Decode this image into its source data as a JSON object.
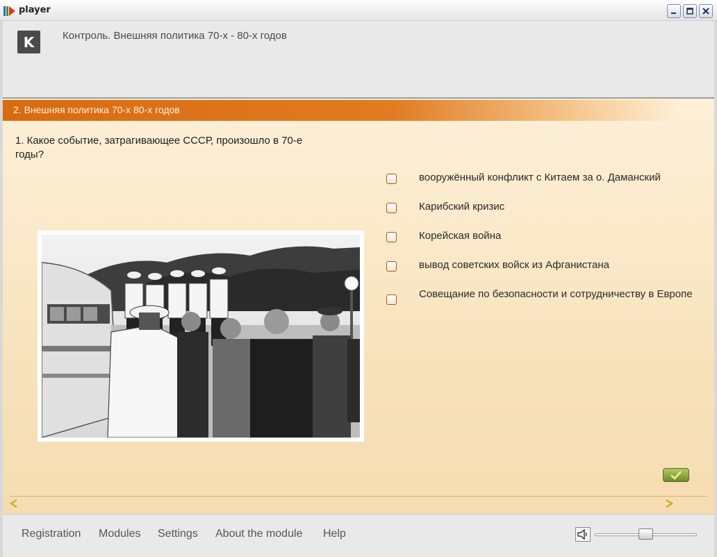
{
  "window": {
    "title": "player"
  },
  "header": {
    "logo_text": "K",
    "course_title": "Контроль. Внешняя политика 70-х - 80-х годов"
  },
  "section": {
    "title": "2. Внешняя политика 70-х 80-х годов"
  },
  "question": {
    "text": "1. Какое событие, затрагивающее СССР, произошло в 70-е годы?",
    "image_icon": "historical-photo"
  },
  "answers": [
    {
      "label": "вооружённый конфликт с Китаем за о. Даманский",
      "checked": false
    },
    {
      "label": "Карибский кризис",
      "checked": false
    },
    {
      "label": "Корейская война",
      "checked": false
    },
    {
      "label": "вывод советских войск из Афганистана",
      "checked": false
    },
    {
      "label": "Совещание по безопасности и сотрудничеству в Европе",
      "checked": false
    }
  ],
  "controls": {
    "submit_icon": "checkmark-icon",
    "prev_icon": "arrow-left-icon",
    "next_icon": "arrow-right-icon"
  },
  "footer": {
    "menu": [
      "Registration",
      "Modules",
      "Settings",
      "About the module",
      "Help"
    ],
    "volume_icon": "speaker-icon",
    "volume_level": 0.5
  },
  "colors": {
    "accent": "#d96a10",
    "background": "#fdf0d8",
    "submit": "#7a9a2c"
  }
}
